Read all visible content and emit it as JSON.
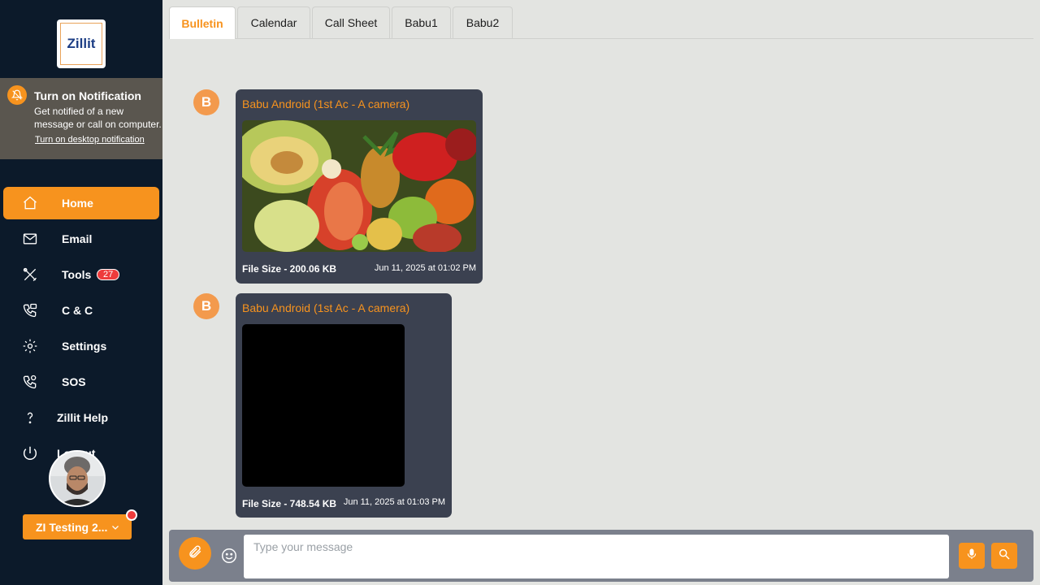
{
  "app": {
    "logo_text": "Zillit"
  },
  "notification": {
    "title": "Turn on Notification",
    "description": "Get notified of a new message or call on computer.",
    "link": "Turn on desktop notification"
  },
  "sidebar": {
    "items": [
      {
        "label": "Home",
        "icon": "home-icon",
        "active": true
      },
      {
        "label": "Email",
        "icon": "mail-icon"
      },
      {
        "label": "Tools",
        "icon": "tools-icon",
        "badge": "27"
      },
      {
        "label": "C & C",
        "icon": "phone-chat-icon"
      },
      {
        "label": "Settings",
        "icon": "gear-icon"
      },
      {
        "label": "SOS",
        "icon": "sos-phone-icon"
      },
      {
        "label": "Zillit Help",
        "icon": "help-icon"
      },
      {
        "label": "Logout",
        "icon": "power-icon"
      }
    ]
  },
  "user": {
    "name": "ZI Testing 2..."
  },
  "tabs": [
    {
      "label": "Bulletin",
      "active": true
    },
    {
      "label": "Calendar"
    },
    {
      "label": "Call Sheet"
    },
    {
      "label": "Babu1"
    },
    {
      "label": "Babu2"
    }
  ],
  "messages": [
    {
      "initial": "B",
      "sender": "Babu Android (1st Ac - A camera)",
      "file_size": "File Size - 200.06 KB",
      "time": "Jun 11, 2025 at 01:02 PM",
      "media": "image"
    },
    {
      "initial": "B",
      "sender": "Babu Android (1st Ac - A camera)",
      "file_size": "File Size - 748.54 KB",
      "time": "Jun 11, 2025 at 01:03 PM",
      "media": "video"
    }
  ],
  "composer": {
    "placeholder": "Type your message"
  },
  "colors": {
    "accent": "#f7931e",
    "sidebar_bg": "#0c1a2a",
    "bubble_bg": "#3b4150",
    "badge_red": "#ee3b3b"
  }
}
